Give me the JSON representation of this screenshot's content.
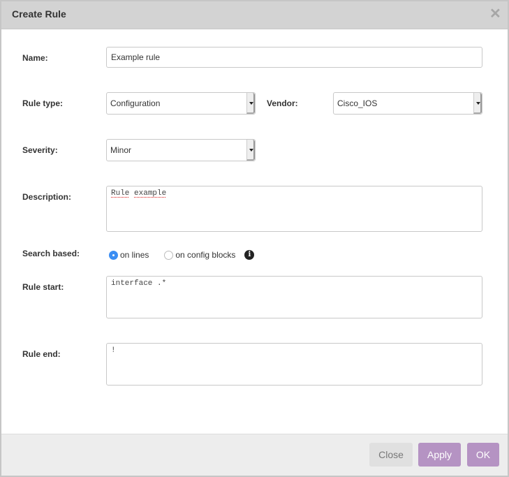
{
  "dialog": {
    "title": "Create Rule",
    "close_icon": "close-x-icon"
  },
  "form": {
    "name": {
      "label": "Name:",
      "value": "Example rule"
    },
    "rule_type": {
      "label": "Rule type:",
      "value": "Configuration"
    },
    "vendor": {
      "label": "Vendor:",
      "value": "Cisco_IOS"
    },
    "severity": {
      "label": "Severity:",
      "value": "Minor"
    },
    "description": {
      "label": "Description:",
      "words": [
        "Rule",
        "example"
      ]
    },
    "search_based": {
      "label": "Search based:",
      "options": [
        {
          "label": "on lines",
          "checked": true
        },
        {
          "label": "on config blocks",
          "checked": false
        }
      ],
      "info_icon": "i"
    },
    "rule_start": {
      "label": "Rule start:",
      "value": "interface .*"
    },
    "rule_end": {
      "label": "Rule end:",
      "value": "!"
    }
  },
  "footer": {
    "close_label": "Close",
    "apply_label": "Apply",
    "ok_label": "OK"
  },
  "colors": {
    "primary_button": "#b593c3",
    "radio_checked": "#3b8ef3",
    "header_bg": "#d3d3d3",
    "footer_bg": "#ededed"
  }
}
